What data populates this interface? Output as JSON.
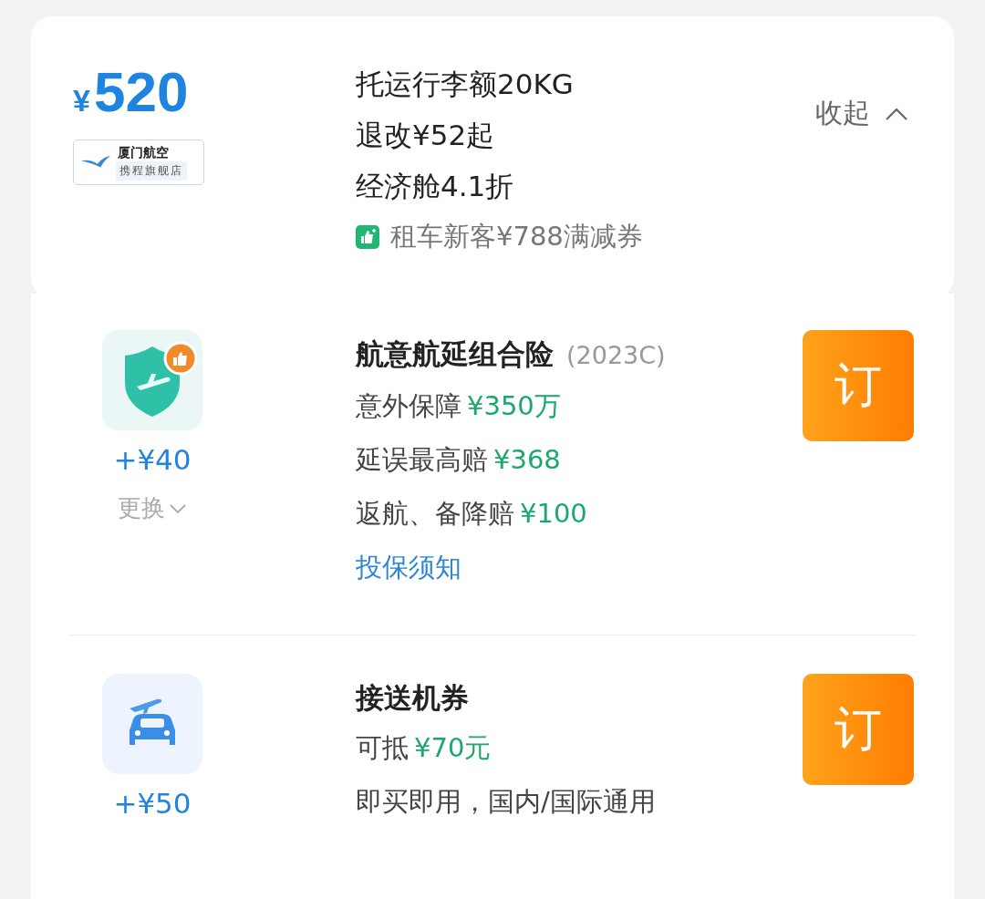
{
  "fare": {
    "price_symbol": "¥",
    "price": "520",
    "airline_badge": {
      "name": "厦门航空",
      "store": "携程旗舰店"
    },
    "details": [
      "托运行李额20KG",
      "退改¥52起",
      "经济舱4.1折"
    ],
    "coupon": "租车新客¥788满减券",
    "collapse": "收起"
  },
  "addons": [
    {
      "kind": "insurance",
      "price": "+¥40",
      "change": "更换",
      "title": "航意航延组合险",
      "code": "(2023C)",
      "lines": [
        {
          "label": "意外保障",
          "value": "¥350万"
        },
        {
          "label": "延误最高赔",
          "value": "¥368"
        },
        {
          "label": "返航、备降赔",
          "value": "¥100"
        }
      ],
      "link": "投保须知",
      "book": "订"
    },
    {
      "kind": "transfer",
      "price": "+¥50",
      "title": "接送机券",
      "lines": [
        {
          "label": "可抵",
          "value": "¥70元"
        },
        {
          "label": "即买即用，国内/国际通用"
        }
      ],
      "book": "订"
    }
  ]
}
